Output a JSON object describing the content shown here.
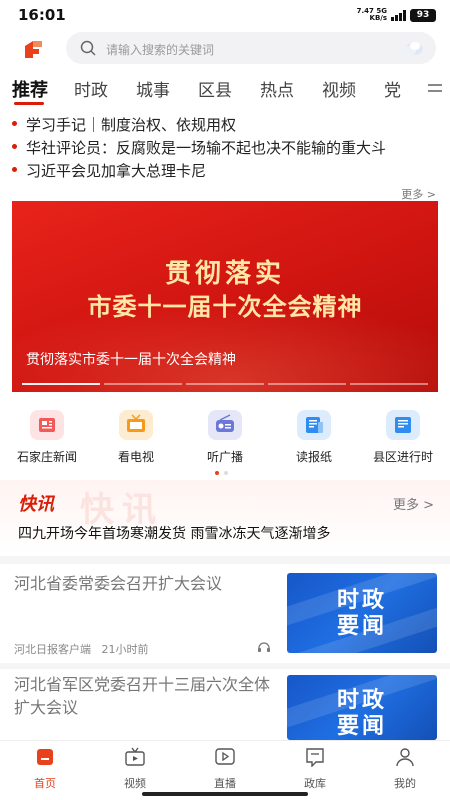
{
  "status": {
    "time": "16:01",
    "net_speed_value": "7.47",
    "net_speed_unit": "KB/s",
    "net_type": "5G",
    "battery": "93"
  },
  "header": {
    "search_placeholder": "请输入搜索的关键词",
    "logo_icon": "app-logo",
    "weather_icon": "cloud-icon"
  },
  "tabs": [
    {
      "label": "推荐",
      "active": true
    },
    {
      "label": "时政"
    },
    {
      "label": "城事"
    },
    {
      "label": "区县"
    },
    {
      "label": "热点"
    },
    {
      "label": "视频"
    },
    {
      "label": "党"
    }
  ],
  "headlines": [
    "学习手记｜制度治权、依规用权",
    "华社评论员：反腐败是一场输不起也决不能输的重大斗",
    "习近平会见加拿大总理卡尼"
  ],
  "headlines_more": "更多 >",
  "banner": {
    "line1": "贯彻落实",
    "line2": "市委十一届十次全会精神",
    "caption": "贯彻落实市委十一届十次全会精神"
  },
  "quick_entries": [
    {
      "label": "石家庄新闻",
      "icon": "news-icon"
    },
    {
      "label": "看电视",
      "icon": "tv-icon"
    },
    {
      "label": "听广播",
      "icon": "radio-icon"
    },
    {
      "label": "读报纸",
      "icon": "newspaper-icon"
    },
    {
      "label": "县区进行时",
      "icon": "county-icon"
    }
  ],
  "flash": {
    "title": "快讯",
    "watermark": "快讯",
    "more": "更多 >",
    "text": "四九开场今年首场寒潮发货 雨雪冰冻天气逐渐增多"
  },
  "articles": [
    {
      "title": "河北省委常委会召开扩大会议",
      "source": "河北日报客户端",
      "time": "21小时前",
      "thumb_line1": "时政",
      "thumb_line2": "要闻"
    },
    {
      "title": "河北省军区党委召开十三届六次全体扩大会议",
      "thumb_line1": "时政",
      "thumb_line2": "要闻"
    }
  ],
  "bottom_nav": [
    {
      "label": "首页",
      "icon": "home-icon",
      "active": true
    },
    {
      "label": "视频",
      "icon": "video-icon"
    },
    {
      "label": "直播",
      "icon": "live-icon"
    },
    {
      "label": "政库",
      "icon": "library-icon"
    },
    {
      "label": "我的",
      "icon": "profile-icon"
    }
  ],
  "colors": {
    "accent": "#d81e06",
    "banner_red": "#cf1410",
    "thumb_blue": "#1f6fe2"
  }
}
